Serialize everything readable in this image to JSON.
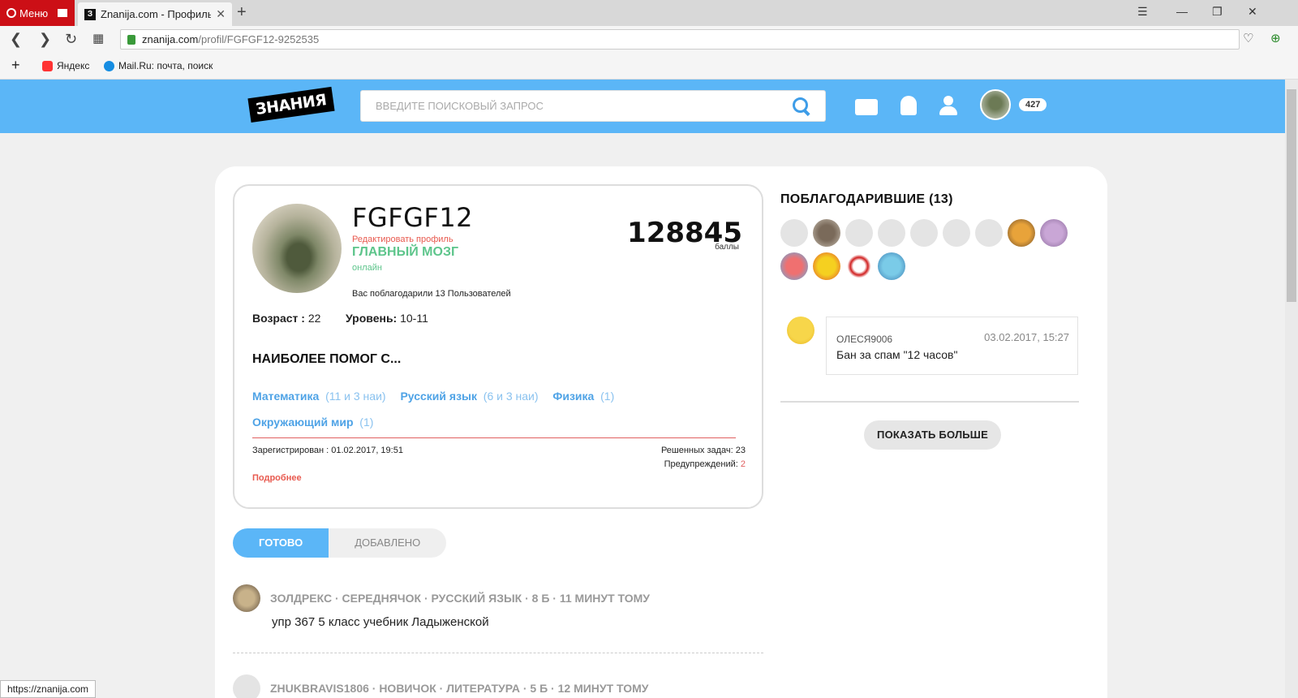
{
  "browser": {
    "menu_label": "Меню",
    "tab_title": "Znanija.com - Профиль пс",
    "tab_favicon": "З",
    "url_host": "znanija.com",
    "url_path": "/profil/FGFGF12-9252535",
    "bookmarks": [
      {
        "label": "Яндекс",
        "icon": "yandex-icon",
        "color": "#ff3333"
      },
      {
        "label": "Mail.Ru: почта, поиск",
        "icon": "mailru-icon",
        "color": "#168de2"
      }
    ],
    "status_url": "https://znanija.com"
  },
  "header": {
    "logo": "ЗНАНИЯ",
    "search_placeholder": "ВВЕДИТЕ ПОИСКОВЫЙ ЗАПРОС",
    "points_badge": "427",
    "accent_color": "#5bb6f7"
  },
  "profile": {
    "username": "FGFGF12",
    "edit_link": "Редактировать профиль",
    "rank": "ГЛАВНЫЙ МОЗГ",
    "status": "онлайн",
    "thanked_text": "Вас поблагодарили 13 Пользователей",
    "points": "128845",
    "points_label": "баллы",
    "age_label": "Возраст :",
    "age_value": " 22",
    "level_label": "Уровень:",
    "level_value": " 10-11",
    "helped_title": "НАИБОЛЕЕ ПОМОГ С...",
    "subjects": [
      {
        "name": "Математика",
        "count": "(11 и 3 наи)"
      },
      {
        "name": "Русский язык",
        "count": "(6 и 3 наи)"
      },
      {
        "name": "Физика",
        "count": "(1)"
      },
      {
        "name": "Окружающий мир",
        "count": "(1)"
      }
    ],
    "registered": "Зарегистрирован : 01.02.2017, 19:51",
    "solved": "Решенных задач: 23",
    "warnings_label": "Предупреждений:",
    "warnings_value": " 2",
    "more_link": "Подробнее"
  },
  "thanks": {
    "title": "ПОБЛАГОДАРИВШИЕ (13)",
    "count": 13
  },
  "comment": {
    "user": "ОЛЕСЯ9006",
    "date": "03.02.2017, 15:27",
    "text": "Бан за спам \"12 часов\""
  },
  "show_more": "ПОКАЗАТЬ БОЛЬШЕ",
  "tabs": [
    {
      "label": "ГОТОВО",
      "active": true
    },
    {
      "label": "ДОБАВЛЕНО",
      "active": false
    }
  ],
  "feed": [
    {
      "meta": "ЗОЛДРЕКС · СЕРЕДНЯЧОК  · РУССКИЙ ЯЗЫК  · 8 Б · 11 МИНУТ ТОМУ",
      "text": "упр 367 5 класс учебник Ладыженской"
    },
    {
      "meta": "ZHUKBRAVIS1806 · НОВИЧОК  · ЛИТЕРАТУРА  · 5 Б · 12 МИНУТ ТОМУ",
      "text": ""
    }
  ]
}
